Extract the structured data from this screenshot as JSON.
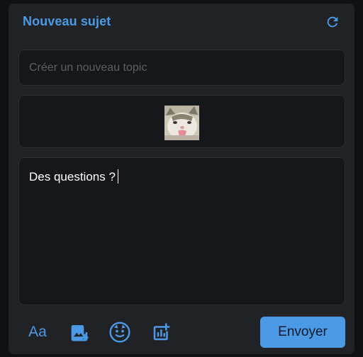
{
  "header": {
    "title": "Nouveau sujet",
    "refresh_icon": "refresh-icon"
  },
  "topic": {
    "placeholder": "Créer un nouveau topic",
    "value": ""
  },
  "attachment": {
    "image_name": "cat-sticker"
  },
  "message": {
    "value": "Des questions ?"
  },
  "toolbar": {
    "text_format_label": "Aa",
    "add_image_icon": "add-image-icon",
    "sticker_icon": "sticker-icon",
    "poll_icon": "add-poll-icon",
    "send_label": "Envoyer"
  },
  "colors": {
    "accent": "#4c9ae6",
    "panel": "#202226",
    "field": "#16171a",
    "background": "#101114"
  }
}
